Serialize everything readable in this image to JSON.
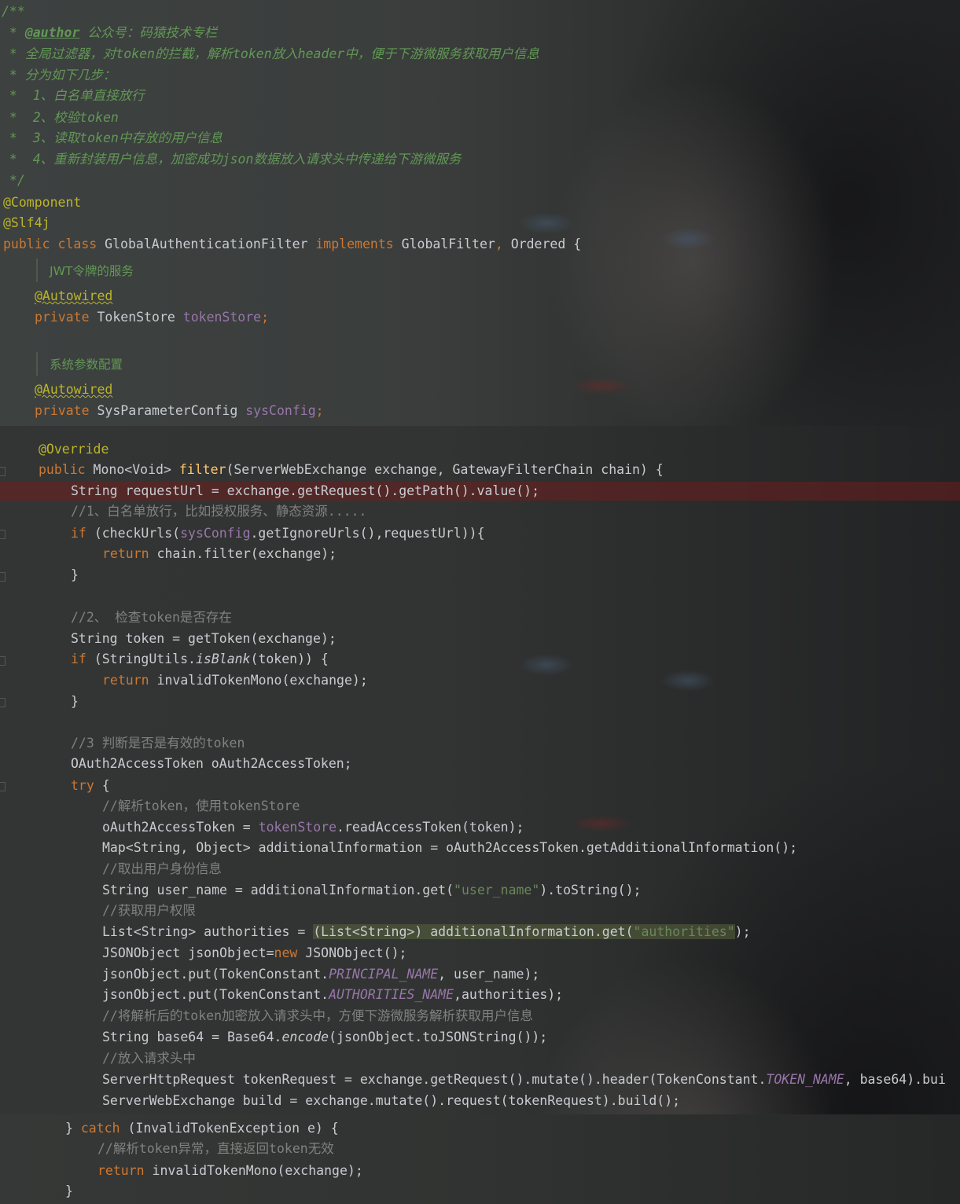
{
  "background": {
    "accent_colors": {
      "keyword": "#cc7832",
      "annotation": "#bbb529",
      "comment": "#629755",
      "field": "#9876aa",
      "method": "#ffc66d",
      "string": "#6a8759",
      "breakpoint_line": "#6e1e1e"
    }
  },
  "javadoc": {
    "open": "/**",
    "author_tag": "@author",
    "author_text": " 公众号：码猿技术专栏",
    "line2": " * 全局过滤器，对token的拦截，解析token放入header中，便于下游微服务获取用户信息",
    "line3": " * 分为如下几步：",
    "line4": " *  1、白名单直接放行",
    "line5": " *  2、校验token",
    "line6": " *  3、读取token中存放的用户信息",
    "line7": " *  4、重新封装用户信息，加密成功json数据放入请求头中传递给下游微服务",
    "close": " */"
  },
  "class_decl": {
    "ann1": "@Component",
    "ann2": "@Slf4j",
    "kw_public": "public",
    "kw_class": "class",
    "name": "GlobalAuthenticationFilter",
    "kw_implements": "implements",
    "iface1": "GlobalFilter",
    "iface2": "Ordered",
    "brace": "{"
  },
  "fields": {
    "doc1": "JWT令牌的服务",
    "autowired": "@Autowired",
    "kw_private": "private",
    "type1": "TokenStore",
    "name1": "tokenStore",
    "doc2": "系统参数配置",
    "type2": "SysParameterConfig",
    "name2": "sysConfig",
    "semi": ";"
  },
  "method": {
    "override": "@Override",
    "sig_type": "Mono<Void>",
    "name": "filter",
    "params": "(ServerWebExchange exchange, GatewayFilterChain chain) {",
    "l1": "String requestUrl = exchange.getRequest().getPath().value();",
    "c1": "//1、白名单放行，比如授权服务、静态资源.....",
    "if1_a": "(checkUrls(",
    "if1_b": "sysConfig",
    "if1_c": ".getIgnoreUrls(),requestUrl)){",
    "kw_if": "if",
    "kw_return": "return",
    "ret1": " chain.filter(exchange);",
    "close": "}",
    "c2": "//2、 检查token是否存在",
    "l2": "String token = getToken(exchange);",
    "if2_a": " (StringUtils.",
    "if2_b": "isBlank",
    "if2_c": "(token)) {",
    "ret2": " invalidTokenMono(exchange);",
    "c3": "//3 判断是否是有效的token",
    "l3": "OAuth2AccessToken oAuth2AccessToken;",
    "kw_try": "try",
    "try_brace": " {",
    "c4": "//解析token，使用tokenStore",
    "l4a": "oAuth2AccessToken = ",
    "l4b": "tokenStore",
    "l4c": ".readAccessToken(token);",
    "l5": "Map<String, Object> additionalInformation = oAuth2AccessToken.getAdditionalInformation();",
    "c5": "//取出用户身份信息",
    "l6a": "String user_name = additionalInformation.get(",
    "l6s": "\"user_name\"",
    "l6b": ").toString();",
    "c6": "//获取用户权限",
    "l7a": "List<String> authorities = ",
    "l7sel": "(List<String>) additionalInformation.get(",
    "l7s": "\"authorities\"",
    "l7b": ");",
    "l8a": "JSONObject jsonObject=",
    "kw_new": "new",
    "l8b": " JSONObject();",
    "l9a": "jsonObject.put(TokenConstant.",
    "l9c": "PRINCIPAL_NAME",
    "l9b": ", user_name);",
    "l10c": "AUTHORITIES_NAME",
    "l10b": ",authorities);",
    "c7": "//将解析后的token加密放入请求头中，方便下游微服务解析获取用户信息",
    "l11a": "String base64 = Base64.",
    "l11i": "encode",
    "l11b": "(jsonObject.toJSONString());",
    "c8": "//放入请求头中",
    "l12a": "ServerHttpRequest tokenRequest = exchange.getRequest().mutate().header(TokenConstant.",
    "l12c": "TOKEN_NAME",
    "l12b": ", base64).bui",
    "l13": "ServerWebExchange build = exchange.mutate().request(tokenRequest).build();",
    "catch_a": "} ",
    "kw_catch": "catch",
    "catch_b": " (InvalidTokenException e) {",
    "c9": "//解析token异常，直接返回token无效",
    "ret3": " invalidTokenMono(exchange);",
    "final_close": "}"
  }
}
